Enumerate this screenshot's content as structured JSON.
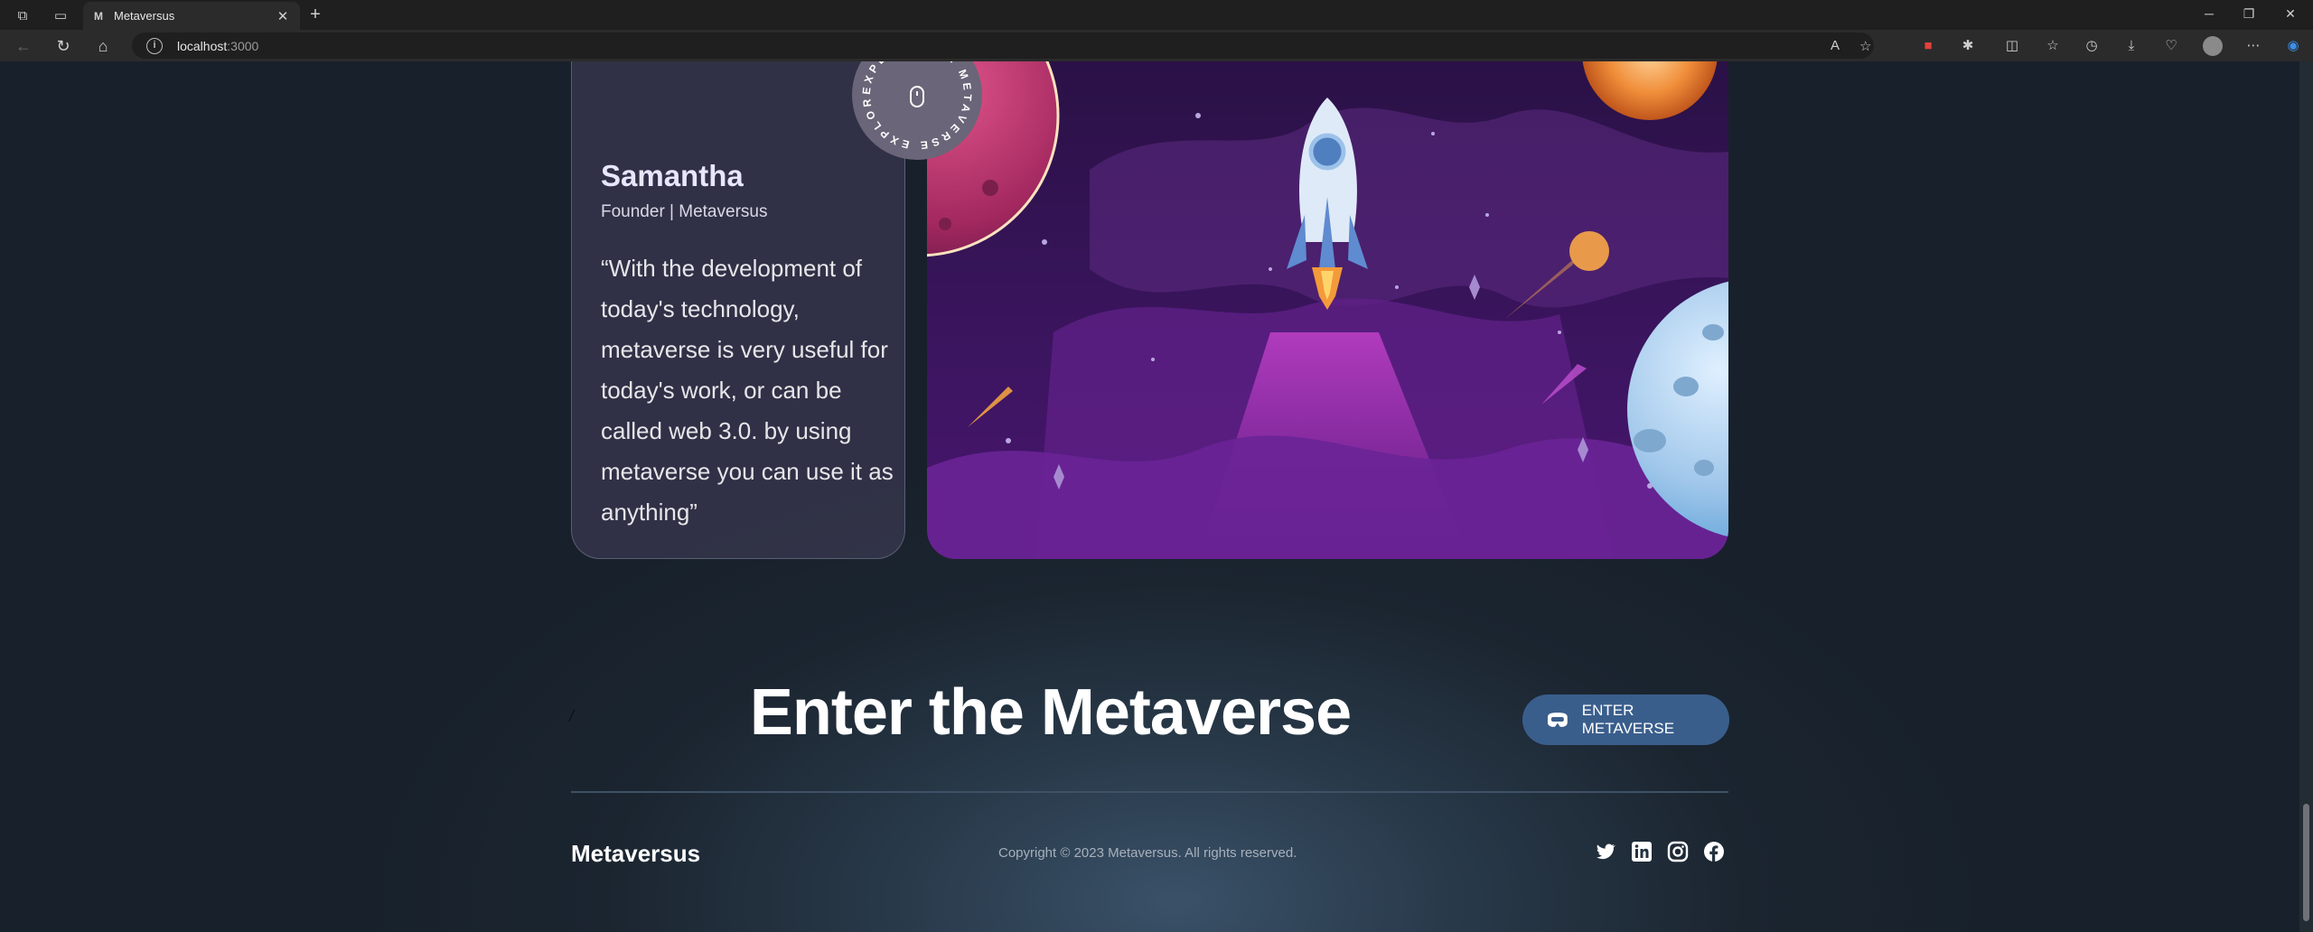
{
  "browser": {
    "tab_title": "Metaversus",
    "tab_favicon": "M",
    "url_host": "localhost",
    "url_port": ":3000"
  },
  "feedback": {
    "name": "Samantha",
    "role": "Founder | Metaversus",
    "quote": "“With the development of today's technology, metaverse is very useful for today's work, or can be called web 3.0. by using metaverse you can use it as anything”"
  },
  "badge": {
    "text": "EXPLORE THE METAVERSE EXPLORE THE METAVERSE"
  },
  "cta": {
    "title": "Enter the Metaverse",
    "button_label": "ENTER METAVERSE",
    "slash": "/"
  },
  "footer": {
    "brand": "Metaversus",
    "copyright": "Copyright © 2023 Metaversus. All rights reserved.",
    "social_icons": [
      "twitter-icon",
      "linkedin-icon",
      "instagram-icon",
      "facebook-icon"
    ]
  },
  "colors": {
    "button_bg": "#3a5e8c",
    "page_bg": "#1a232e",
    "art_purple": "#4a1a6e"
  }
}
